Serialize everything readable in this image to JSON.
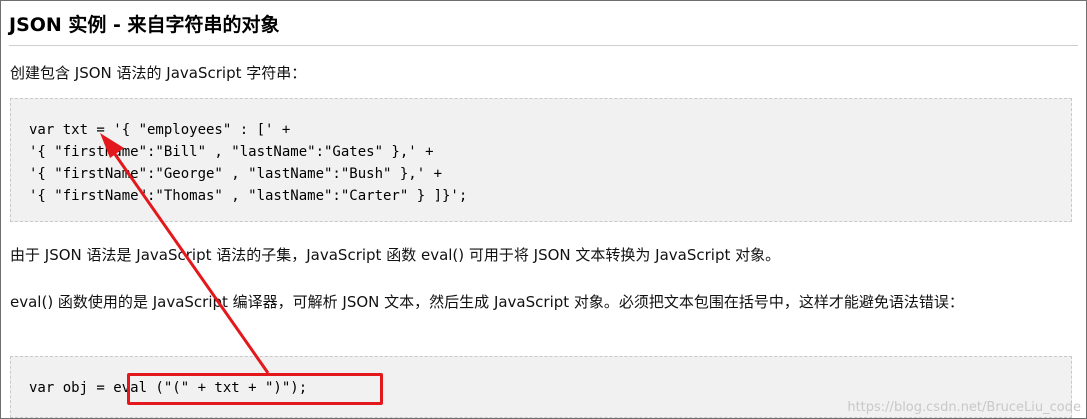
{
  "article": {
    "title": "JSON 实例 - 来自字符串的对象",
    "intro": "创建包含 JSON 语法的 JavaScript 字符串：",
    "code_block_1": [
      "var txt = '{ \"employees\" : [' +",
      "'{ \"firstName\":\"Bill\" , \"lastName\":\"Gates\" },' +",
      "'{ \"firstName\":\"George\" , \"lastName\":\"Bush\" },' +",
      "'{ \"firstName\":\"Thomas\" , \"lastName\":\"Carter\" } ]}';"
    ],
    "para_2": "由于 JSON 语法是 JavaScript 语法的子集，JavaScript 函数 eval() 可用于将 JSON 文本转换为 JavaScript 对象。",
    "para_3": "eval() 函数使用的是 JavaScript 编译器，可解析 JSON 文本，然后生成 JavaScript 对象。必须把文本包围在括号中，这样才能避免语法错误：",
    "code_block_2": [
      "var obj = eval (\"(\" + txt + \")\");"
    ]
  },
  "watermark": "https://blog.csdn.net/BruceLiu_code",
  "annotation": {
    "color": "#e3181c"
  }
}
